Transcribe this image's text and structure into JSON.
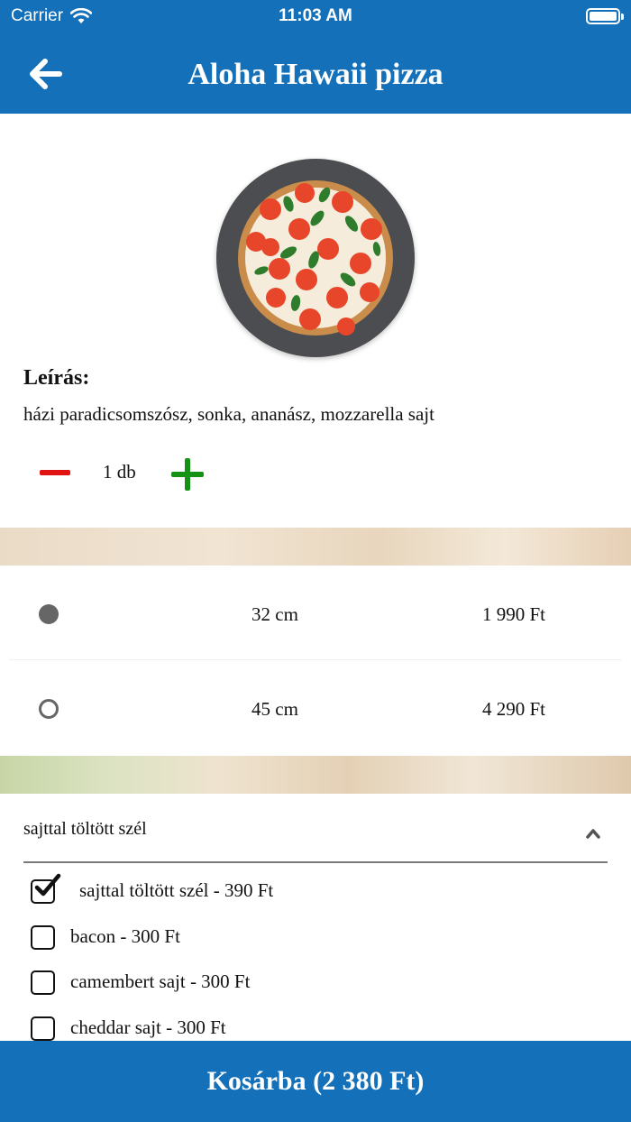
{
  "status": {
    "carrier": "Carrier",
    "time": "11:03 AM",
    "wifi_icon": "wifi-icon",
    "battery_icon": "battery-icon"
  },
  "header": {
    "title": "Aloha Hawaii pizza",
    "back_icon": "arrow-left-icon"
  },
  "product": {
    "image": "pizza-photo",
    "description_label": "Leírás:",
    "description": "házi paradicsomszósz, sonka, ananász, mozzarella  sajt"
  },
  "quantity": {
    "value": "1 db",
    "minus_icon": "minus-icon",
    "plus_icon": "plus-icon"
  },
  "sizes": [
    {
      "size": "32 cm",
      "price": "1 990 Ft",
      "selected": true
    },
    {
      "size": "45 cm",
      "price": "4 290 Ft",
      "selected": false
    }
  ],
  "extras": {
    "group_label": "sajttal töltött szél",
    "items": [
      {
        "label": "sajttal töltött szél - 390 Ft",
        "checked": true
      },
      {
        "label": "bacon - 300 Ft",
        "checked": false
      },
      {
        "label": "camembert sajt - 300 Ft",
        "checked": false
      },
      {
        "label": "cheddar sajt - 300 Ft",
        "checked": false
      }
    ]
  },
  "cart": {
    "label": "Kosárba (2 380 Ft)"
  },
  "colors": {
    "primary": "#1470b8",
    "minus": "#e11212",
    "plus": "#139213"
  }
}
